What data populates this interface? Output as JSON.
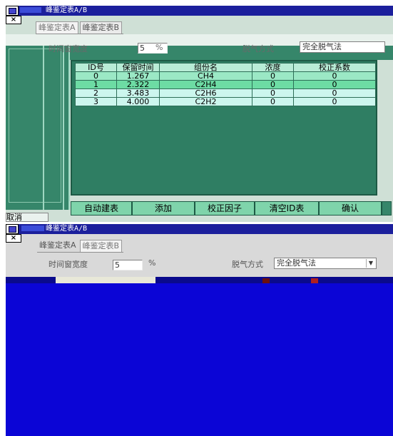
{
  "window_top": {
    "title": "峰鉴定表A/B",
    "close_label": "×",
    "tabs": [
      {
        "label": "峰鉴定表A",
        "active": true
      },
      {
        "label": "峰鉴定表B",
        "active": false
      }
    ],
    "time_window_label": "时间窗宽度",
    "time_window_value": "5",
    "unit_percent": "%",
    "degas_label": "脱气方式",
    "degas_value": "完全脱气法",
    "table": {
      "headers": [
        "ID号",
        "保留时间",
        "组份名",
        "浓度",
        "校正系数"
      ],
      "rows": [
        [
          "0",
          "1.267",
          "CH4",
          "0",
          "0"
        ],
        [
          "1",
          "2.322",
          "C2H4",
          "0",
          "0"
        ],
        [
          "2",
          "3.483",
          "C2H6",
          "0",
          "0"
        ],
        [
          "3",
          "4.000",
          "C2H2",
          "0",
          "0"
        ]
      ]
    },
    "buttons": [
      {
        "label": "自动建表"
      },
      {
        "label": "添加"
      },
      {
        "label": "校正因子"
      },
      {
        "label": "清空ID表"
      },
      {
        "label": "确认"
      }
    ],
    "cancel_label": "取消"
  },
  "window_bottom": {
    "title": "峰鉴定表A/B",
    "close_label": "×",
    "tabs": [
      {
        "label": "峰鉴定表A",
        "active": false
      },
      {
        "label": "峰鉴定表B",
        "active": true
      }
    ],
    "time_window_label": "时间窗宽度",
    "time_window_value": "5",
    "unit_percent": "%",
    "degas_label": "脱气方式",
    "degas_value": "完全脱气法"
  },
  "colors": {
    "titlebar": "#1b1f9c",
    "grid_bg": "#2f7e63",
    "blue_panel": "#0b05d6"
  }
}
